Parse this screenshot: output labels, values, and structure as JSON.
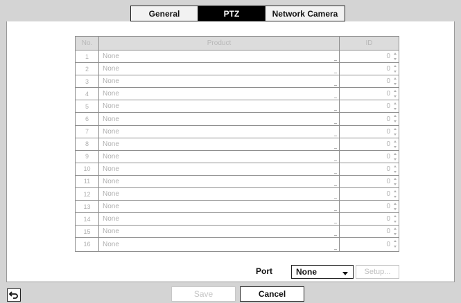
{
  "tabs": [
    {
      "label": "General",
      "active": false
    },
    {
      "label": "PTZ",
      "active": true
    },
    {
      "label": "Network Camera",
      "active": false
    }
  ],
  "table": {
    "headers": {
      "no": "No.",
      "product": "Product",
      "id": "ID"
    },
    "rows": [
      {
        "no": "1",
        "product": "None",
        "id": "0"
      },
      {
        "no": "2",
        "product": "None",
        "id": "0"
      },
      {
        "no": "3",
        "product": "None",
        "id": "0"
      },
      {
        "no": "4",
        "product": "None",
        "id": "0"
      },
      {
        "no": "5",
        "product": "None",
        "id": "0"
      },
      {
        "no": "6",
        "product": "None",
        "id": "0"
      },
      {
        "no": "7",
        "product": "None",
        "id": "0"
      },
      {
        "no": "8",
        "product": "None",
        "id": "0"
      },
      {
        "no": "9",
        "product": "None",
        "id": "0"
      },
      {
        "no": "10",
        "product": "None",
        "id": "0"
      },
      {
        "no": "11",
        "product": "None",
        "id": "0"
      },
      {
        "no": "12",
        "product": "None",
        "id": "0"
      },
      {
        "no": "13",
        "product": "None",
        "id": "0"
      },
      {
        "no": "14",
        "product": "None",
        "id": "0"
      },
      {
        "no": "15",
        "product": "None",
        "id": "0"
      },
      {
        "no": "16",
        "product": "None",
        "id": "0"
      }
    ]
  },
  "port": {
    "label": "Port",
    "value": "None",
    "setup_label": "Setup..."
  },
  "footer": {
    "back_icon": "back-arrow-icon",
    "save_label": "Save",
    "cancel_label": "Cancel"
  }
}
